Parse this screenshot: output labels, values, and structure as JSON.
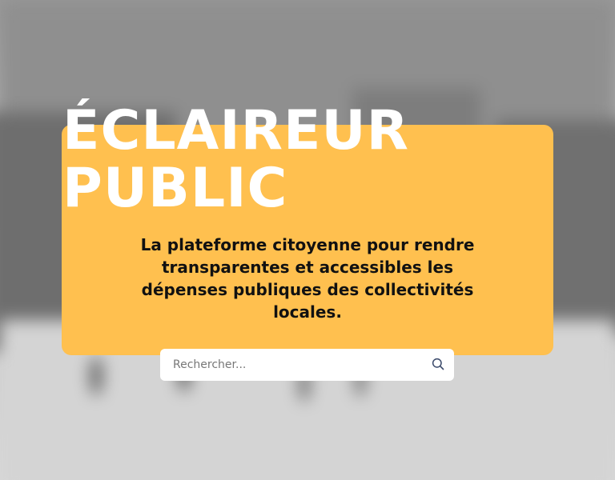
{
  "hero": {
    "title": "ÉCLAIREUR\nPUBLIC",
    "tagline": "La plateforme citoyenne pour rendre transparentes et accessibles les dépenses publiques des collectivités locales."
  },
  "search": {
    "placeholder": "Rechercher...",
    "value": "",
    "icon": "search-icon"
  },
  "colors": {
    "accent": "#ffc04f",
    "title": "#ffffff",
    "tagline": "#111111",
    "icon": "#3b4a6b"
  }
}
